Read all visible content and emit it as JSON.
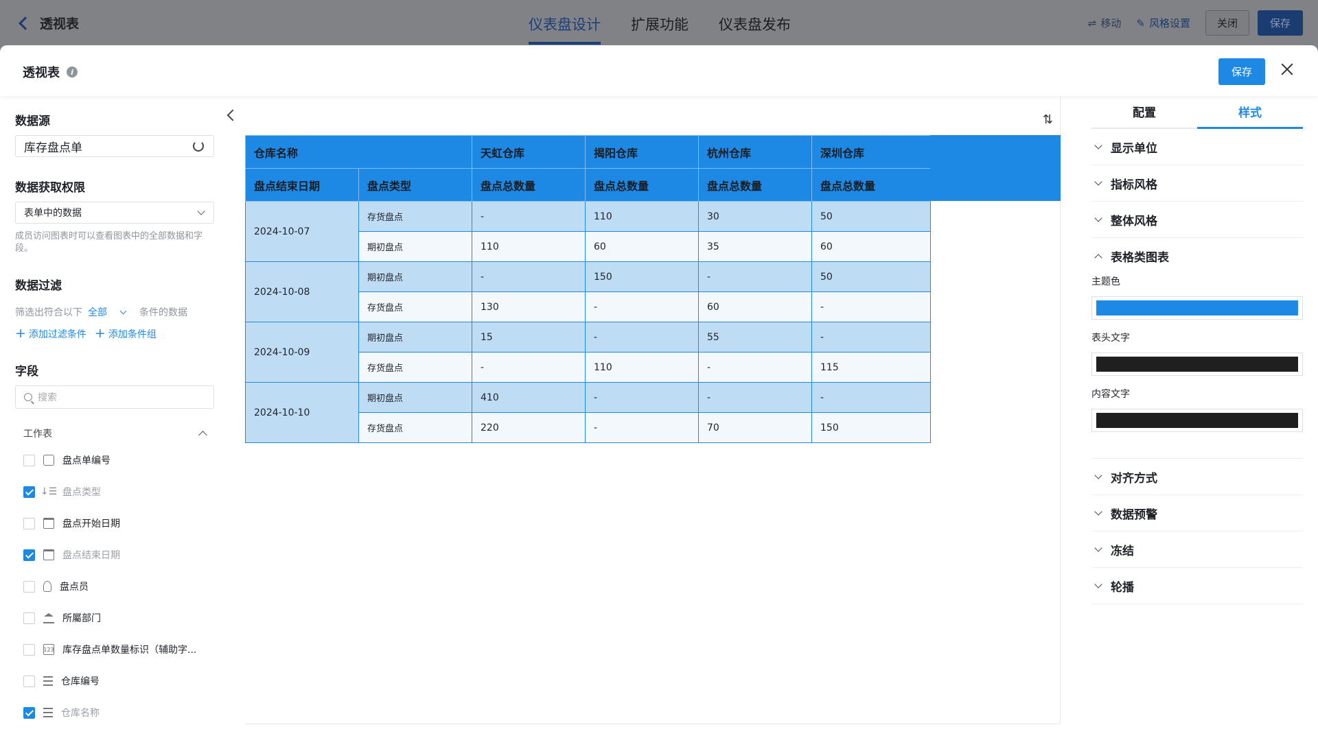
{
  "topbar": {
    "back_label": "透视表",
    "tabs": [
      "仪表盘设计",
      "扩展功能",
      "仪表盘发布"
    ],
    "move_label": "移动",
    "style_label": "风格设置",
    "close_label": "关闭",
    "save_label": "保存"
  },
  "modal": {
    "title": "透视表",
    "save_label": "保存"
  },
  "left": {
    "datasource_title": "数据源",
    "datasource_value": "库存盘点单",
    "permission_title": "数据获取权限",
    "permission_value": "表单中的数据",
    "permission_hint": "成员访问图表时可以查看图表中的全部数据和字段。",
    "filter_title": "数据过滤",
    "filter_prefix": "筛选出符合以下",
    "filter_mode": "全部",
    "filter_suffix": "条件的数据",
    "add_filter": "添加过滤条件",
    "add_group": "添加条件组",
    "fields_title": "字段",
    "search_placeholder": "搜索",
    "group_name": "工作表",
    "fields": [
      {
        "label": "盘点单编号",
        "checked": false,
        "icon": "doc-icon"
      },
      {
        "label": "盘点类型",
        "checked": true,
        "icon": "sort-icon"
      },
      {
        "label": "盘点开始日期",
        "checked": false,
        "icon": "calendar-icon"
      },
      {
        "label": "盘点结束日期",
        "checked": true,
        "icon": "calendar-icon"
      },
      {
        "label": "盘点员",
        "checked": false,
        "icon": "person-icon"
      },
      {
        "label": "所屬部门",
        "checked": false,
        "icon": "bank-icon"
      },
      {
        "label": "库存盘点单数量标识（辅助字...",
        "checked": false,
        "icon": "number-icon"
      },
      {
        "label": "仓库编号",
        "checked": false,
        "icon": "lines-icon"
      },
      {
        "label": "仓库名称",
        "checked": true,
        "icon": "lines-icon"
      }
    ]
  },
  "pivot": {
    "corner_top": "仓库名称",
    "corner_left1": "盘点结束日期",
    "corner_left2": "盘点类型",
    "warehouses": [
      "天虹仓库",
      "揭阳仓库",
      "杭州仓库",
      "深圳仓库"
    ],
    "measure": "盘点总数量",
    "groups": [
      {
        "date": "2024-10-07",
        "rows": [
          {
            "type": "存货盘点",
            "values": [
              "-",
              "110",
              "30",
              "50"
            ]
          },
          {
            "type": "期初盘点",
            "values": [
              "110",
              "60",
              "35",
              "60"
            ]
          }
        ]
      },
      {
        "date": "2024-10-08",
        "rows": [
          {
            "type": "期初盘点",
            "values": [
              "-",
              "150",
              "-",
              "50"
            ]
          },
          {
            "type": "存货盘点",
            "values": [
              "130",
              "-",
              "60",
              "-"
            ]
          }
        ]
      },
      {
        "date": "2024-10-09",
        "rows": [
          {
            "type": "期初盘点",
            "values": [
              "15",
              "-",
              "55",
              "-"
            ]
          },
          {
            "type": "存货盘点",
            "values": [
              "-",
              "110",
              "-",
              "115"
            ]
          }
        ]
      },
      {
        "date": "2024-10-10",
        "rows": [
          {
            "type": "期初盘点",
            "values": [
              "410",
              "-",
              "-",
              "-"
            ]
          },
          {
            "type": "存货盘点",
            "values": [
              "220",
              "-",
              "70",
              "150"
            ]
          }
        ]
      }
    ]
  },
  "right": {
    "tabs": [
      "配置",
      "样式"
    ],
    "sections_top": [
      "显示单位",
      "指标风格",
      "整体风格"
    ],
    "table_section": "表格类图表",
    "theme_color_label": "主题色",
    "theme_color": "#1e88e5",
    "header_text_label": "表头文字",
    "header_text_color": "#1f1f1f",
    "content_text_label": "内容文字",
    "content_text_color": "#1f1f1f",
    "sections_bottom": [
      "对齐方式",
      "数据预警",
      "冻结",
      "轮播"
    ]
  }
}
